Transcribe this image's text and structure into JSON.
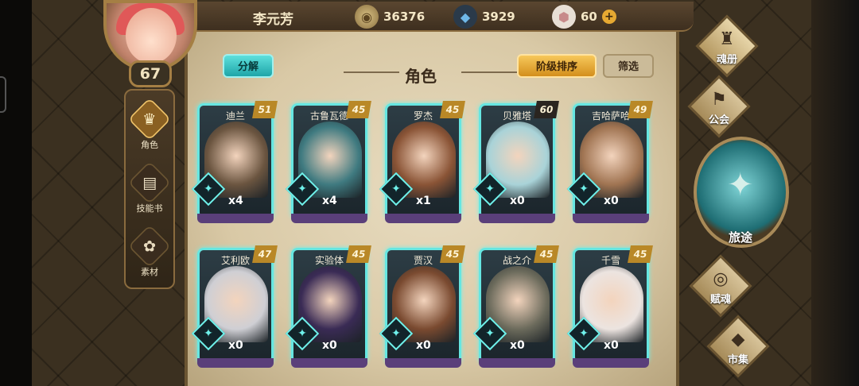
{
  "player": {
    "name": "李元芳",
    "level": "67"
  },
  "resources": {
    "coins": "36376",
    "gems": "3929",
    "crystals": "60",
    "plus": "+"
  },
  "page": {
    "title": "角色"
  },
  "buttons": {
    "decompose": "分解",
    "sort": "阶级排序",
    "filter": "筛选"
  },
  "sidemenu": [
    {
      "label": "角色",
      "icon": "helmet-icon",
      "glyph": "♛"
    },
    {
      "label": "技能书",
      "icon": "book-icon",
      "glyph": "▤"
    },
    {
      "label": "素材",
      "icon": "material-icon",
      "glyph": "✿"
    }
  ],
  "rightmenu": [
    {
      "label": "魂册",
      "icon": "soul-book-icon",
      "glyph": "♜"
    },
    {
      "label": "公会",
      "icon": "guild-icon",
      "glyph": "⚑"
    },
    {
      "label": "旅途",
      "icon": "journey-icon",
      "glyph": "✦"
    },
    {
      "label": "赋魂",
      "icon": "spiral-icon",
      "glyph": "◎"
    },
    {
      "label": "市集",
      "icon": "market-icon",
      "glyph": "◆"
    }
  ],
  "characters": [
    {
      "name": "迪兰",
      "level": "51",
      "count": "x4",
      "color": "#6b5540"
    },
    {
      "name": "古鲁瓦德",
      "level": "45",
      "count": "x4",
      "color": "#3f7a80"
    },
    {
      "name": "罗杰",
      "level": "45",
      "count": "x1",
      "color": "#8a5436"
    },
    {
      "name": "贝雅塔",
      "level": "60",
      "count": "x0",
      "color": "#a9d3d8"
    },
    {
      "name": "吉哈萨哈",
      "level": "49",
      "count": "x0",
      "color": "#a07452"
    },
    {
      "name": "艾利欧",
      "level": "47",
      "count": "x0",
      "color": "#cfcfd4"
    },
    {
      "name": "实验体",
      "level": "45",
      "count": "x0",
      "color": "#3a2b55"
    },
    {
      "name": "贾汉",
      "level": "45",
      "count": "x0",
      "color": "#7a4a30"
    },
    {
      "name": "战之介",
      "level": "45",
      "count": "x0",
      "color": "#6c6b5c"
    },
    {
      "name": "千雪",
      "level": "45",
      "count": "x0",
      "color": "#ece4e0"
    }
  ]
}
